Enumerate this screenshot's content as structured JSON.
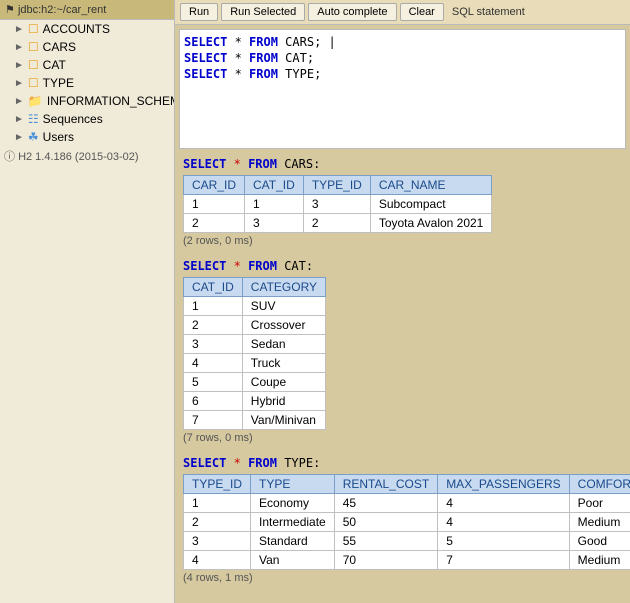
{
  "sidebar": {
    "connection": "jdbc:h2:~/car_rent",
    "items": [
      {
        "label": "ACCOUNTS",
        "type": "table",
        "indent": 1
      },
      {
        "label": "CARS",
        "type": "table",
        "indent": 1
      },
      {
        "label": "CAT",
        "type": "table",
        "indent": 1
      },
      {
        "label": "TYPE",
        "type": "table",
        "indent": 1
      },
      {
        "label": "INFORMATION_SCHEMA",
        "type": "folder",
        "indent": 1
      },
      {
        "label": "Sequences",
        "type": "sequences",
        "indent": 1
      },
      {
        "label": "Users",
        "type": "users",
        "indent": 1
      }
    ],
    "info": "H2 1.4.186 (2015-03-02)"
  },
  "toolbar": {
    "run_label": "Run",
    "run_selected_label": "Run Selected",
    "auto_complete_label": "Auto complete",
    "clear_label": "Clear",
    "sql_statement_label": "SQL statement"
  },
  "editor": {
    "lines": [
      "SELECT * FROM CARS;",
      "SELECT * FROM CAT;",
      "SELECT * FROM TYPE;"
    ]
  },
  "results": {
    "cars": {
      "sql": "SELECT * FROM CARS:",
      "columns": [
        "CAR_ID",
        "CAT_ID",
        "TYPE_ID",
        "CAR_NAME"
      ],
      "rows": [
        [
          "1",
          "1",
          "3",
          "Subcompact"
        ],
        [
          "2",
          "3",
          "2",
          "Toyota Avalon 2021"
        ]
      ],
      "row_count": "(2 rows, 0 ms)"
    },
    "cat": {
      "sql": "SELECT * FROM CAT:",
      "columns": [
        "CAT_ID",
        "CATEGORY"
      ],
      "rows": [
        [
          "1",
          "SUV"
        ],
        [
          "2",
          "Crossover"
        ],
        [
          "3",
          "Sedan"
        ],
        [
          "4",
          "Truck"
        ],
        [
          "5",
          "Coupe"
        ],
        [
          "6",
          "Hybrid"
        ],
        [
          "7",
          "Van/Minivan"
        ]
      ],
      "row_count": "(7 rows, 0 ms)"
    },
    "type": {
      "sql": "SELECT * FROM TYPE:",
      "columns": [
        "TYPE_ID",
        "TYPE",
        "RENTAL_COST",
        "MAX_PASSENGERS",
        "COMFORT_LEVEL"
      ],
      "rows": [
        [
          "1",
          "Economy",
          "45",
          "4",
          "Poor"
        ],
        [
          "2",
          "Intermediate",
          "50",
          "4",
          "Medium"
        ],
        [
          "3",
          "Standard",
          "55",
          "5",
          "Good"
        ],
        [
          "4",
          "Van",
          "70",
          "7",
          "Medium"
        ]
      ],
      "row_count": "(4 rows, 1 ms)"
    }
  }
}
